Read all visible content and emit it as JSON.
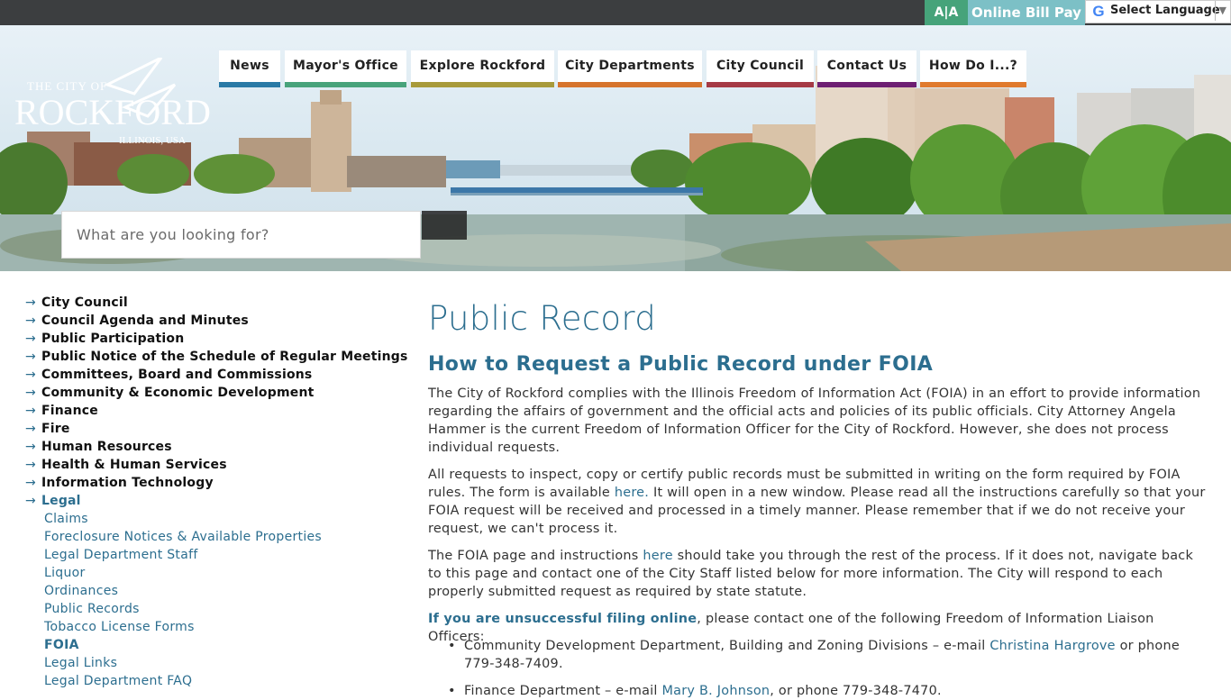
{
  "topbar": {
    "aa_label": "A|A",
    "bill_pay_label": "Online Bill Pay",
    "language_label": "Select Language",
    "language_icon": "google-g-icon",
    "language_arrow": "▼"
  },
  "logo": {
    "line1": "THE CITY OF",
    "line2": "ROCKFORD",
    "line3": "ILLINOIS, USA"
  },
  "nav": {
    "items": [
      {
        "label": "News",
        "color": "#2a7aa6"
      },
      {
        "label": "Mayor's Office",
        "color": "#48a37b"
      },
      {
        "label": "Explore Rockford",
        "color": "#a89a3a"
      },
      {
        "label": "City Departments",
        "color": "#d6742d"
      },
      {
        "label": "City Council",
        "color": "#a53a45"
      },
      {
        "label": "Contact Us",
        "color": "#6e1f73"
      },
      {
        "label": "How Do I...?",
        "color": "#e07a2d"
      }
    ]
  },
  "search": {
    "placeholder": "What are you looking for?"
  },
  "sidebar": {
    "arrow": "→",
    "items": [
      "City Council",
      "Council Agenda and Minutes",
      "Public Participation",
      "Public Notice of the Schedule of Regular Meetings",
      "Committees, Board and Commissions",
      "Community & Economic Development",
      "Finance",
      "Fire",
      "Human Resources",
      "Health & Human Services",
      "Information Technology",
      "Legal"
    ],
    "sub_items": [
      "Claims",
      "Foreclosure Notices & Available Properties",
      "Legal Department Staff",
      "Liquor",
      "Ordinances",
      "Public Records",
      "Tobacco License Forms",
      "FOIA",
      "Legal Links",
      "Legal Department FAQ"
    ]
  },
  "main": {
    "title": "Public Record",
    "subtitle": "How to Request a Public Record under FOIA",
    "p1": "The City of Rockford complies with the Illinois Freedom of Information Act (FOIA) in an effort to provide information regarding the affairs of government and the official acts and policies of its public officials.  City Attorney Angela Hammer is the current Freedom of Information Officer for the City of Rockford.  However, she does not process individual requests.",
    "p2a": "All requests to inspect, copy or certify public records must be submitted in writing on the form required by FOIA rules.  The form is available ",
    "p2_link": "here.",
    "p2b": " It will open in a new window.  Please read all the instructions carefully so that your FOIA request will be received and processed in a timely manner.  Please remember that if we do not receive your request, we can't process it.",
    "p3a": "The FOIA page and instructions ",
    "p3_link": "here",
    "p3b": " should take you through the rest of the process.  If it does not, navigate back to this page and contact one of the City Staff listed below for more information.  The City will respond to each properly submitted request as required by state statute.",
    "p4_link": "If you are unsuccessful filing online",
    "p4b": ", please contact one of the following Freedom of Information Liaison Officers:",
    "bullet1a": "Community Development Department, Building and Zoning Divisions – e-mail ",
    "bullet1_link": "Christina Hargrove",
    "bullet1b": " or phone 779-348-7409.",
    "bullet2a": "Finance Department – e-mail ",
    "bullet2_link": "Mary B. Johnson",
    "bullet2b": ", or phone 779-348-7470."
  }
}
